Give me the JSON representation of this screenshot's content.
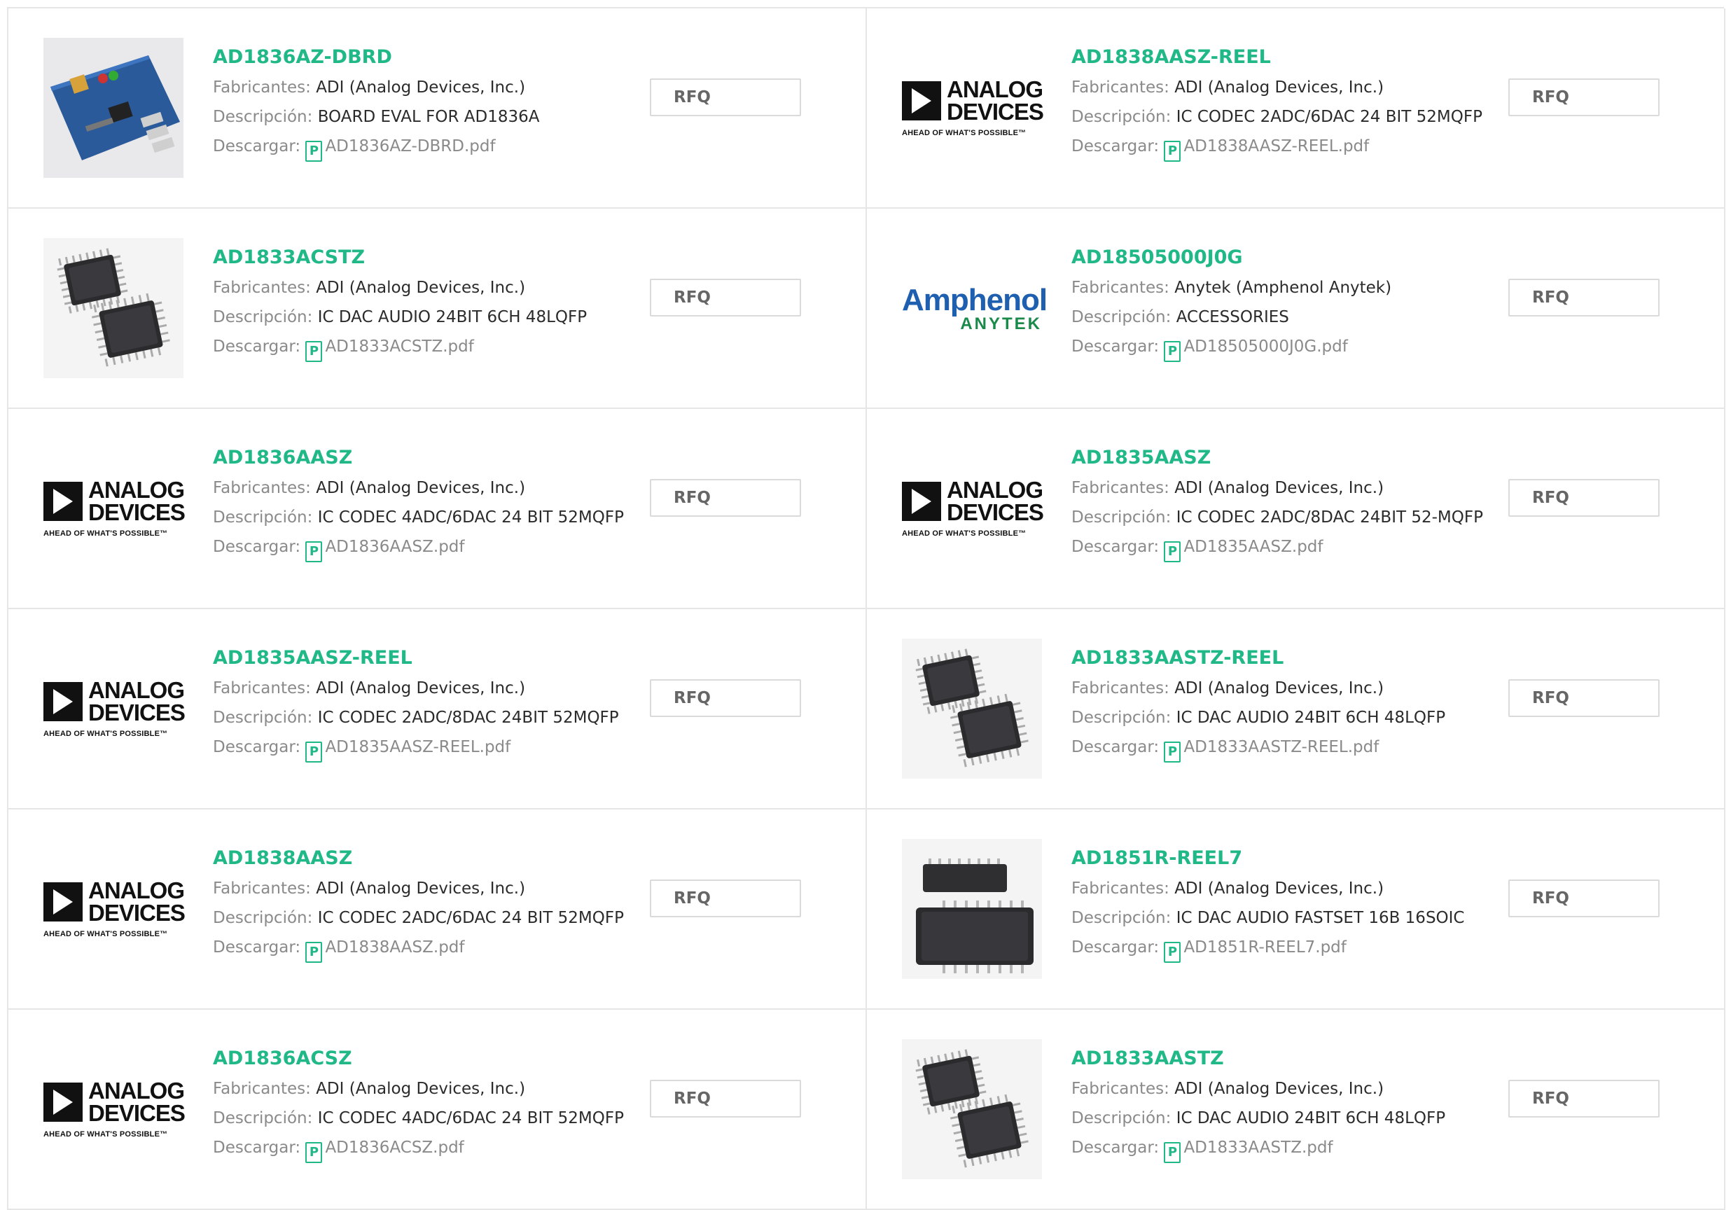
{
  "labels": {
    "manufacturer": "Fabricantes:",
    "description": "Descripción:",
    "download": "Descargar:",
    "rfq": "RFQ"
  },
  "logos": {
    "adi_line1": "ANALOG",
    "adi_line2": "DEVICES",
    "adi_tagline": "AHEAD OF WHAT'S POSSIBLE™",
    "amphenol_line1": "Amphenol",
    "amphenol_line2": "ANYTEK"
  },
  "colors": {
    "accent": "#20b887",
    "label": "#8a8a8a",
    "border": "#e6e6e6"
  },
  "products": [
    {
      "part": "AD1836AZ-DBRD",
      "manufacturer": "ADI (Analog Devices, Inc.)",
      "description": "BOARD EVAL FOR AD1836A",
      "pdf": "AD1836AZ-DBRD.pdf",
      "thumb": "board"
    },
    {
      "part": "AD1838AASZ-REEL",
      "manufacturer": "ADI (Analog Devices, Inc.)",
      "description": "IC CODEC 2ADC/6DAC 24 BIT 52MQFP",
      "pdf": "AD1838AASZ-REEL.pdf",
      "thumb": "adi"
    },
    {
      "part": "AD1833ACSTZ",
      "manufacturer": "ADI (Analog Devices, Inc.)",
      "description": "IC DAC AUDIO 24BIT 6CH 48LQFP",
      "pdf": "AD1833ACSTZ.pdf",
      "thumb": "qfp"
    },
    {
      "part": "AD18505000J0G",
      "manufacturer": "Anytek (Amphenol Anytek)",
      "description": "ACCESSORIES",
      "pdf": "AD18505000J0G.pdf",
      "thumb": "amphenol"
    },
    {
      "part": "AD1836AASZ",
      "manufacturer": "ADI (Analog Devices, Inc.)",
      "description": "IC CODEC 4ADC/6DAC 24 BIT 52MQFP",
      "pdf": "AD1836AASZ.pdf",
      "thumb": "adi"
    },
    {
      "part": "AD1835AASZ",
      "manufacturer": "ADI (Analog Devices, Inc.)",
      "description": "IC CODEC 2ADC/8DAC 24BIT 52-MQFP",
      "pdf": "AD1835AASZ.pdf",
      "thumb": "adi"
    },
    {
      "part": "AD1835AASZ-REEL",
      "manufacturer": "ADI (Analog Devices, Inc.)",
      "description": "IC CODEC 2ADC/8DAC 24BIT 52MQFP",
      "pdf": "AD1835AASZ-REEL.pdf",
      "thumb": "adi"
    },
    {
      "part": "AD1833AASTZ-REEL",
      "manufacturer": "ADI (Analog Devices, Inc.)",
      "description": "IC DAC AUDIO 24BIT 6CH 48LQFP",
      "pdf": "AD1833AASTZ-REEL.pdf",
      "thumb": "qfp"
    },
    {
      "part": "AD1838AASZ",
      "manufacturer": "ADI (Analog Devices, Inc.)",
      "description": "IC CODEC 2ADC/6DAC 24 BIT 52MQFP",
      "pdf": "AD1838AASZ.pdf",
      "thumb": "adi"
    },
    {
      "part": "AD1851R-REEL7",
      "manufacturer": "ADI (Analog Devices, Inc.)",
      "description": "IC DAC AUDIO FASTSET 16B 16SOIC",
      "pdf": "AD1851R-REEL7.pdf",
      "thumb": "soic"
    },
    {
      "part": "AD1836ACSZ",
      "manufacturer": "ADI (Analog Devices, Inc.)",
      "description": "IC CODEC 4ADC/6DAC 24 BIT 52MQFP",
      "pdf": "AD1836ACSZ.pdf",
      "thumb": "adi"
    },
    {
      "part": "AD1833AASTZ",
      "manufacturer": "ADI (Analog Devices, Inc.)",
      "description": "IC DAC AUDIO 24BIT 6CH 48LQFP",
      "pdf": "AD1833AASTZ.pdf",
      "thumb": "qfp"
    }
  ]
}
